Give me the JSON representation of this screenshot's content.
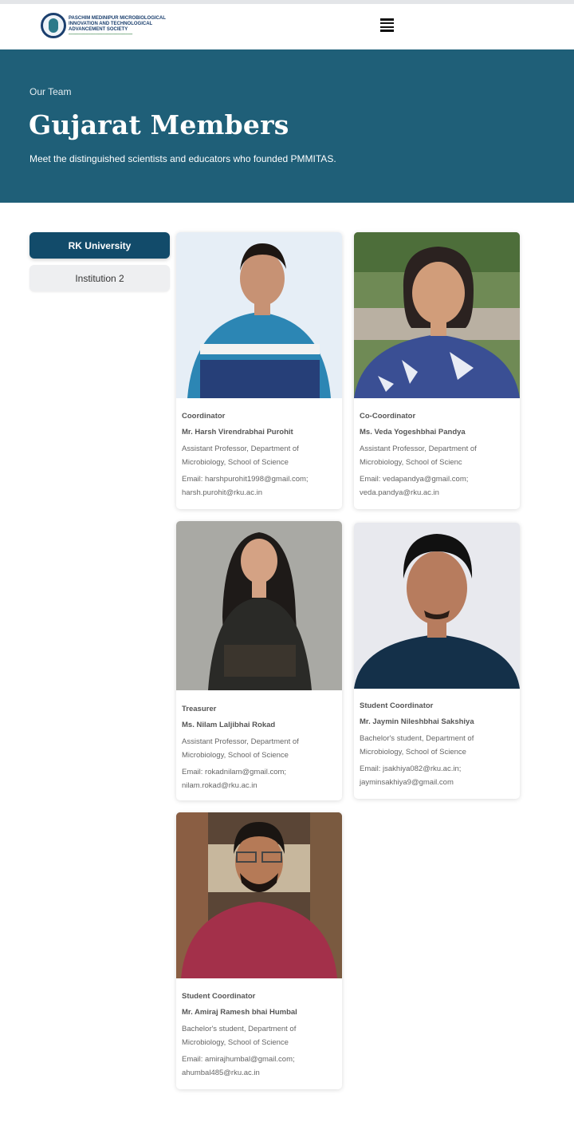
{
  "brand": {
    "logo_lines": [
      "PASCHIM MEDINIPUR MICROBIOLOGICAL",
      "INNOVATION AND TECHNOLOGICAL",
      "ADVANCEMENT SOCIETY"
    ]
  },
  "nav": {
    "menu_icon": "hamburger-menu-icon"
  },
  "hero": {
    "eyebrow": "Our Team",
    "title": "Gujarat Members",
    "subtitle": "Meet the distinguished scientists and educators who founded PMMITAS."
  },
  "tabs": [
    {
      "label": "RK University",
      "active": true
    },
    {
      "label": "Institution 2",
      "active": false
    }
  ],
  "colors": {
    "hero_bg": "#1f5f78",
    "active_tab": "#124b6a"
  },
  "members": [
    {
      "role": "Coordinator",
      "name": "Mr. Harsh Virendrabhai Purohit",
      "desc_1": "Assistant Professor, Department of",
      "desc_2": "Microbiology, School of Science",
      "email_1": "Email: harshpurohit1998@gmail.com;",
      "email_2": "harsh.purohit@rku.ac.in"
    },
    {
      "role": "Co-Coordinator",
      "name": "Ms. Veda Yogeshbhai Pandya",
      "desc_1": "Assistant Professor, Department of",
      "desc_2": "Microbiology, School of Scienc",
      "email_1": "Email: vedapandya@gmail.com;",
      "email_2": "veda.pandya@rku.ac.in"
    },
    {
      "role": "Treasurer",
      "name": "Ms. Nilam Laljibhai Rokad",
      "desc_1": "Assistant Professor, Department of",
      "desc_2": "Microbiology, School of Science",
      "email_1": "Email: rokadnilam@gmail.com;",
      "email_2": "nilam.rokad@rku.ac.in"
    },
    {
      "role": "Student Coordinator",
      "name": "Mr. Jaymin Nileshbhai Sakshiya",
      "desc_1": "Bachelor's student, Department of",
      "desc_2": "Microbiology, School of Science",
      "email_1": "Email: jsakhiya082@rku.ac.in;",
      "email_2": "jayminsakhiya9@gmail.com"
    },
    {
      "role": "Student Coordinator",
      "name": "Mr. Amiraj Ramesh bhai Humbal",
      "desc_1": "Bachelor's student, Department of",
      "desc_2": "Microbiology, School of Science",
      "email_1": "Email: amirajhumbal@gmail.com;",
      "email_2": "ahumbal485@rku.ac.in"
    }
  ]
}
